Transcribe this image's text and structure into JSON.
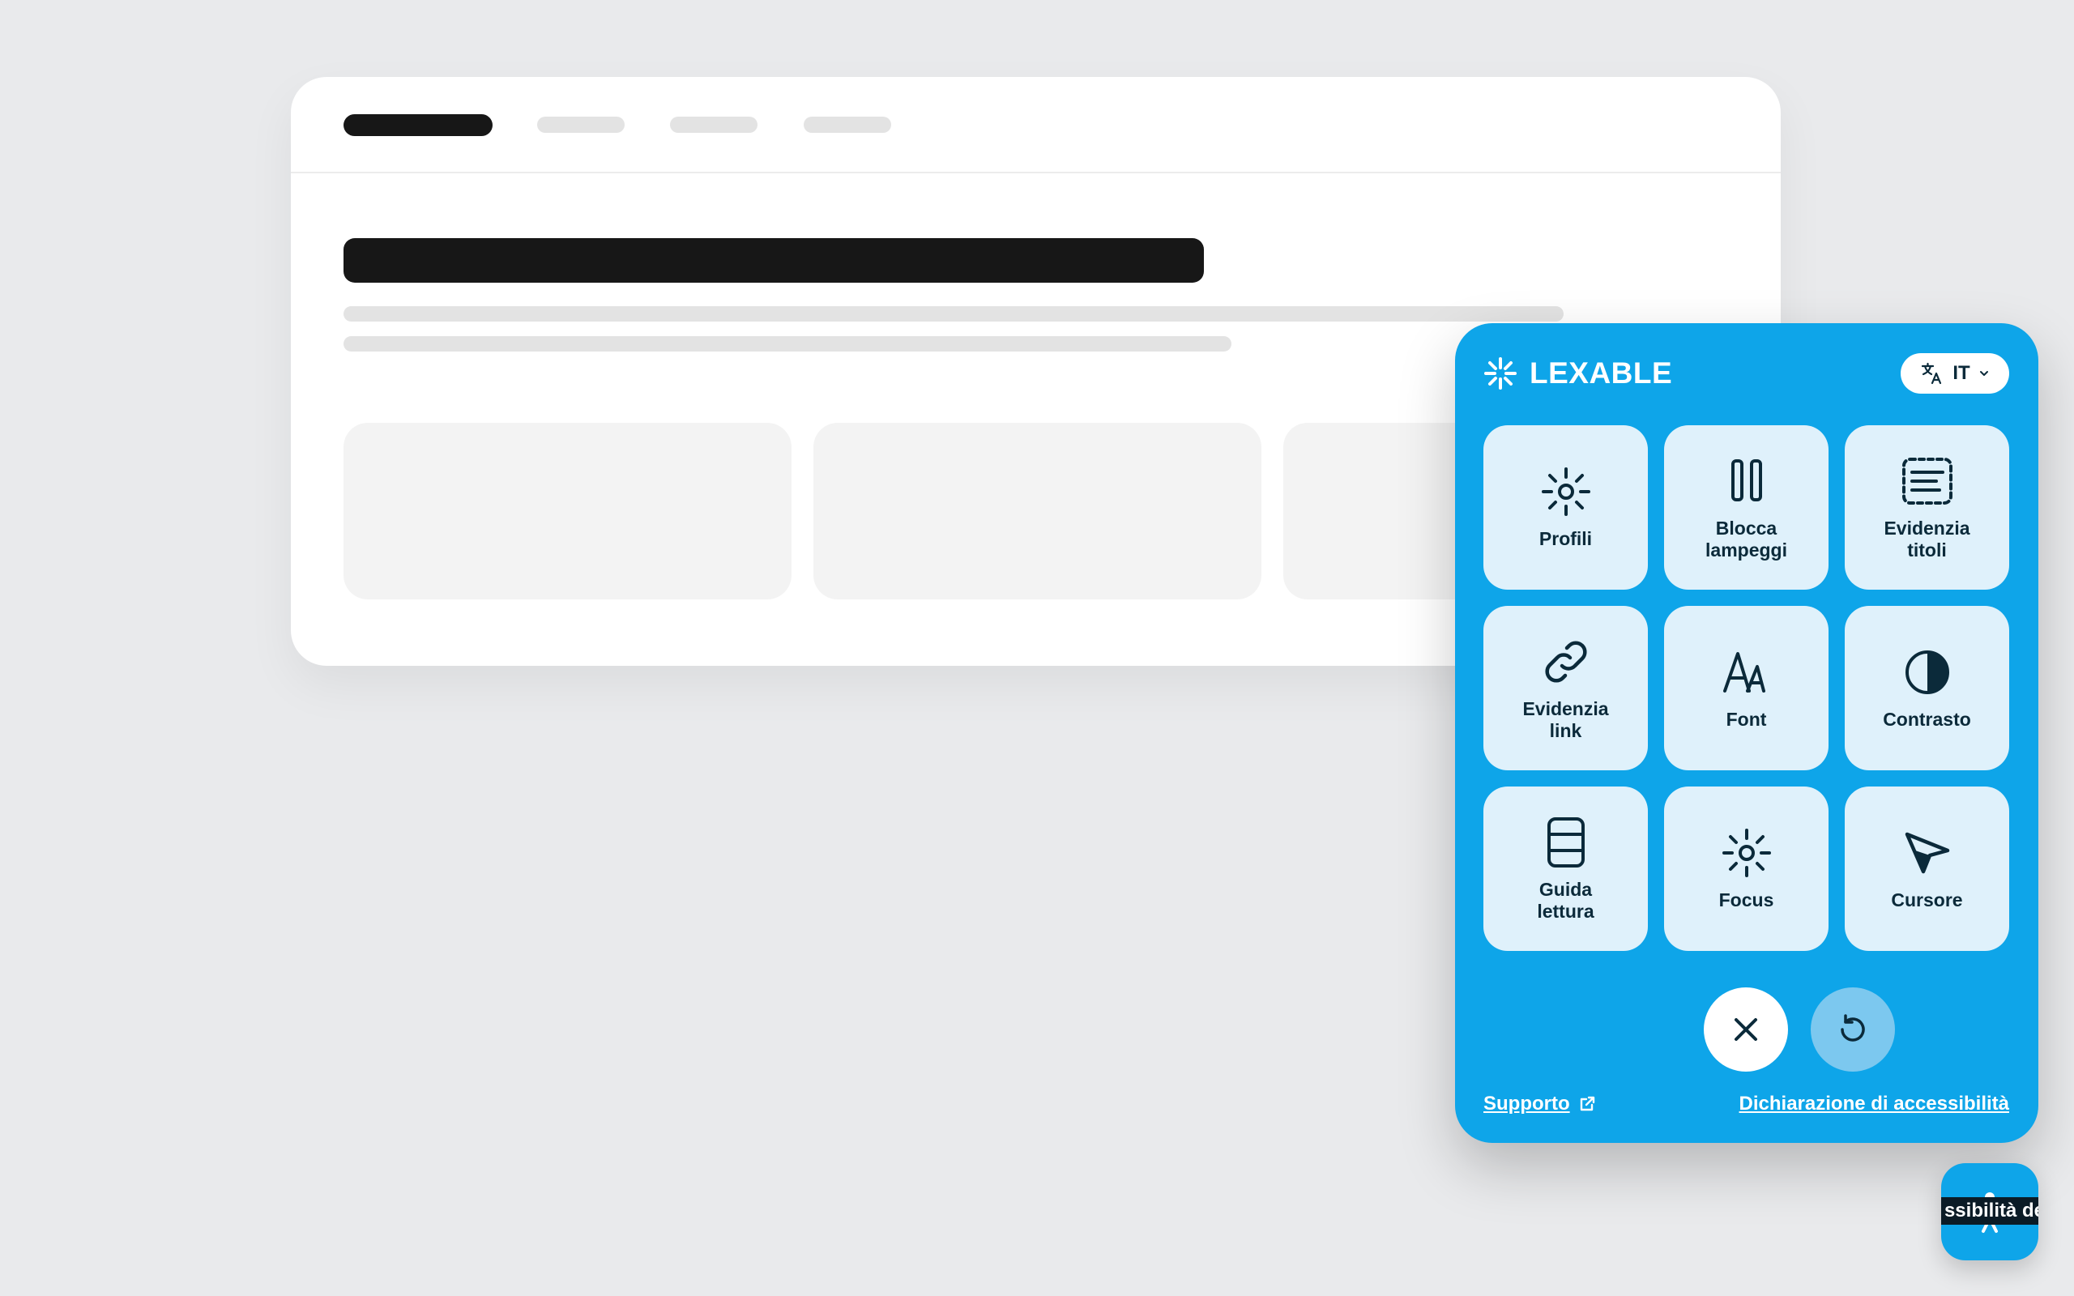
{
  "colors": {
    "page_background": "#e9eaec",
    "widget_accent": "#0ea5e9",
    "tile_background": "#dff1fb",
    "icon_dark": "#0b2a3a"
  },
  "widget": {
    "brand": {
      "name": "LEXABLE",
      "logo_icon": "sparkle-burst-icon"
    },
    "language": {
      "selected": "IT",
      "icon": "translate-icon",
      "chevron_icon": "chevron-down-icon"
    },
    "tiles": [
      {
        "id": "profiles",
        "label": "Profili",
        "icon": "sun-gear-icon"
      },
      {
        "id": "stop-animations",
        "label": "Blocca\nlampeggi",
        "icon": "pause-icon"
      },
      {
        "id": "highlight-titles",
        "label": "Evidenzia\ntitoli",
        "icon": "dashed-headings-icon"
      },
      {
        "id": "highlight-links",
        "label": "Evidenzia\nlink",
        "icon": "link-icon"
      },
      {
        "id": "font",
        "label": "Font",
        "icon": "font-icon"
      },
      {
        "id": "contrast",
        "label": "Contrasto",
        "icon": "contrast-icon"
      },
      {
        "id": "reading-guide",
        "label": "Guida\nlettura",
        "icon": "reading-guide-icon"
      },
      {
        "id": "focus",
        "label": "Focus",
        "icon": "focus-sun-icon"
      },
      {
        "id": "cursor",
        "label": "Cursore",
        "icon": "cursor-icon"
      }
    ],
    "actions": {
      "close_icon": "close-icon",
      "reset_icon": "reset-icon"
    },
    "footer": {
      "support_label": "Supporto",
      "support_icon": "external-link-icon",
      "statement_label": "Dichiarazione di accessibilità"
    }
  },
  "launcher": {
    "tooltip_text": "ssibilità de",
    "icon": "accessibility-person-icon"
  }
}
